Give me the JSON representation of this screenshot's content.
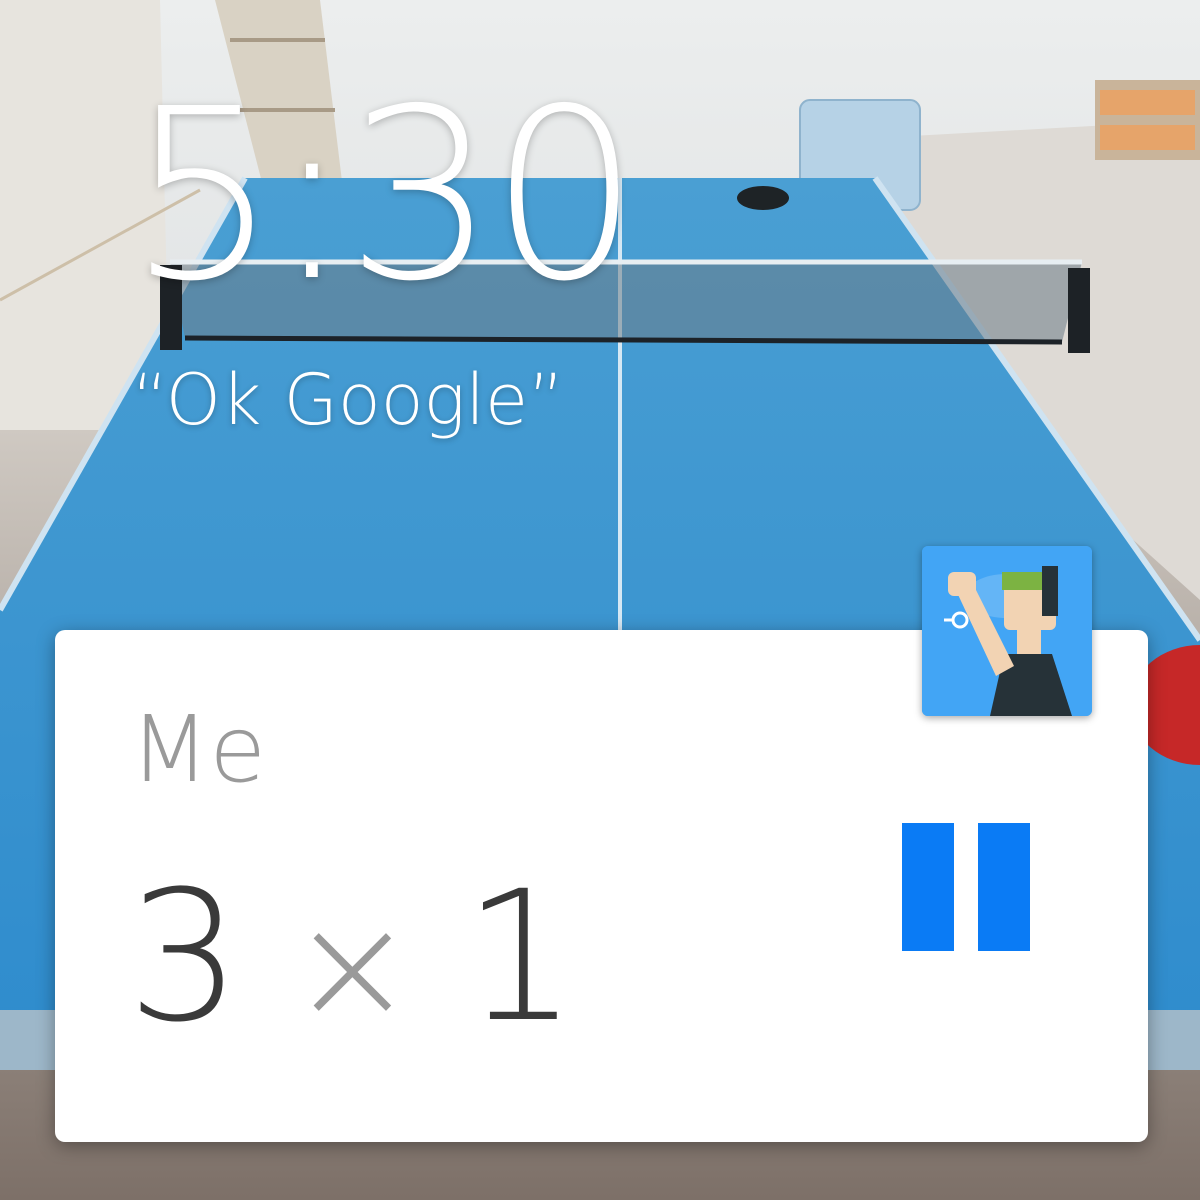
{
  "watch_face": {
    "time": "5:30",
    "hotword_prompt": "“Ok Google”"
  },
  "notification_card": {
    "title": "Me",
    "score_left": "3",
    "score_separator": "×",
    "score_right": "1",
    "action_icon": "pause-icon",
    "accent_color": "#0a7bf5",
    "app_icon": "ping-pong-player-icon"
  }
}
